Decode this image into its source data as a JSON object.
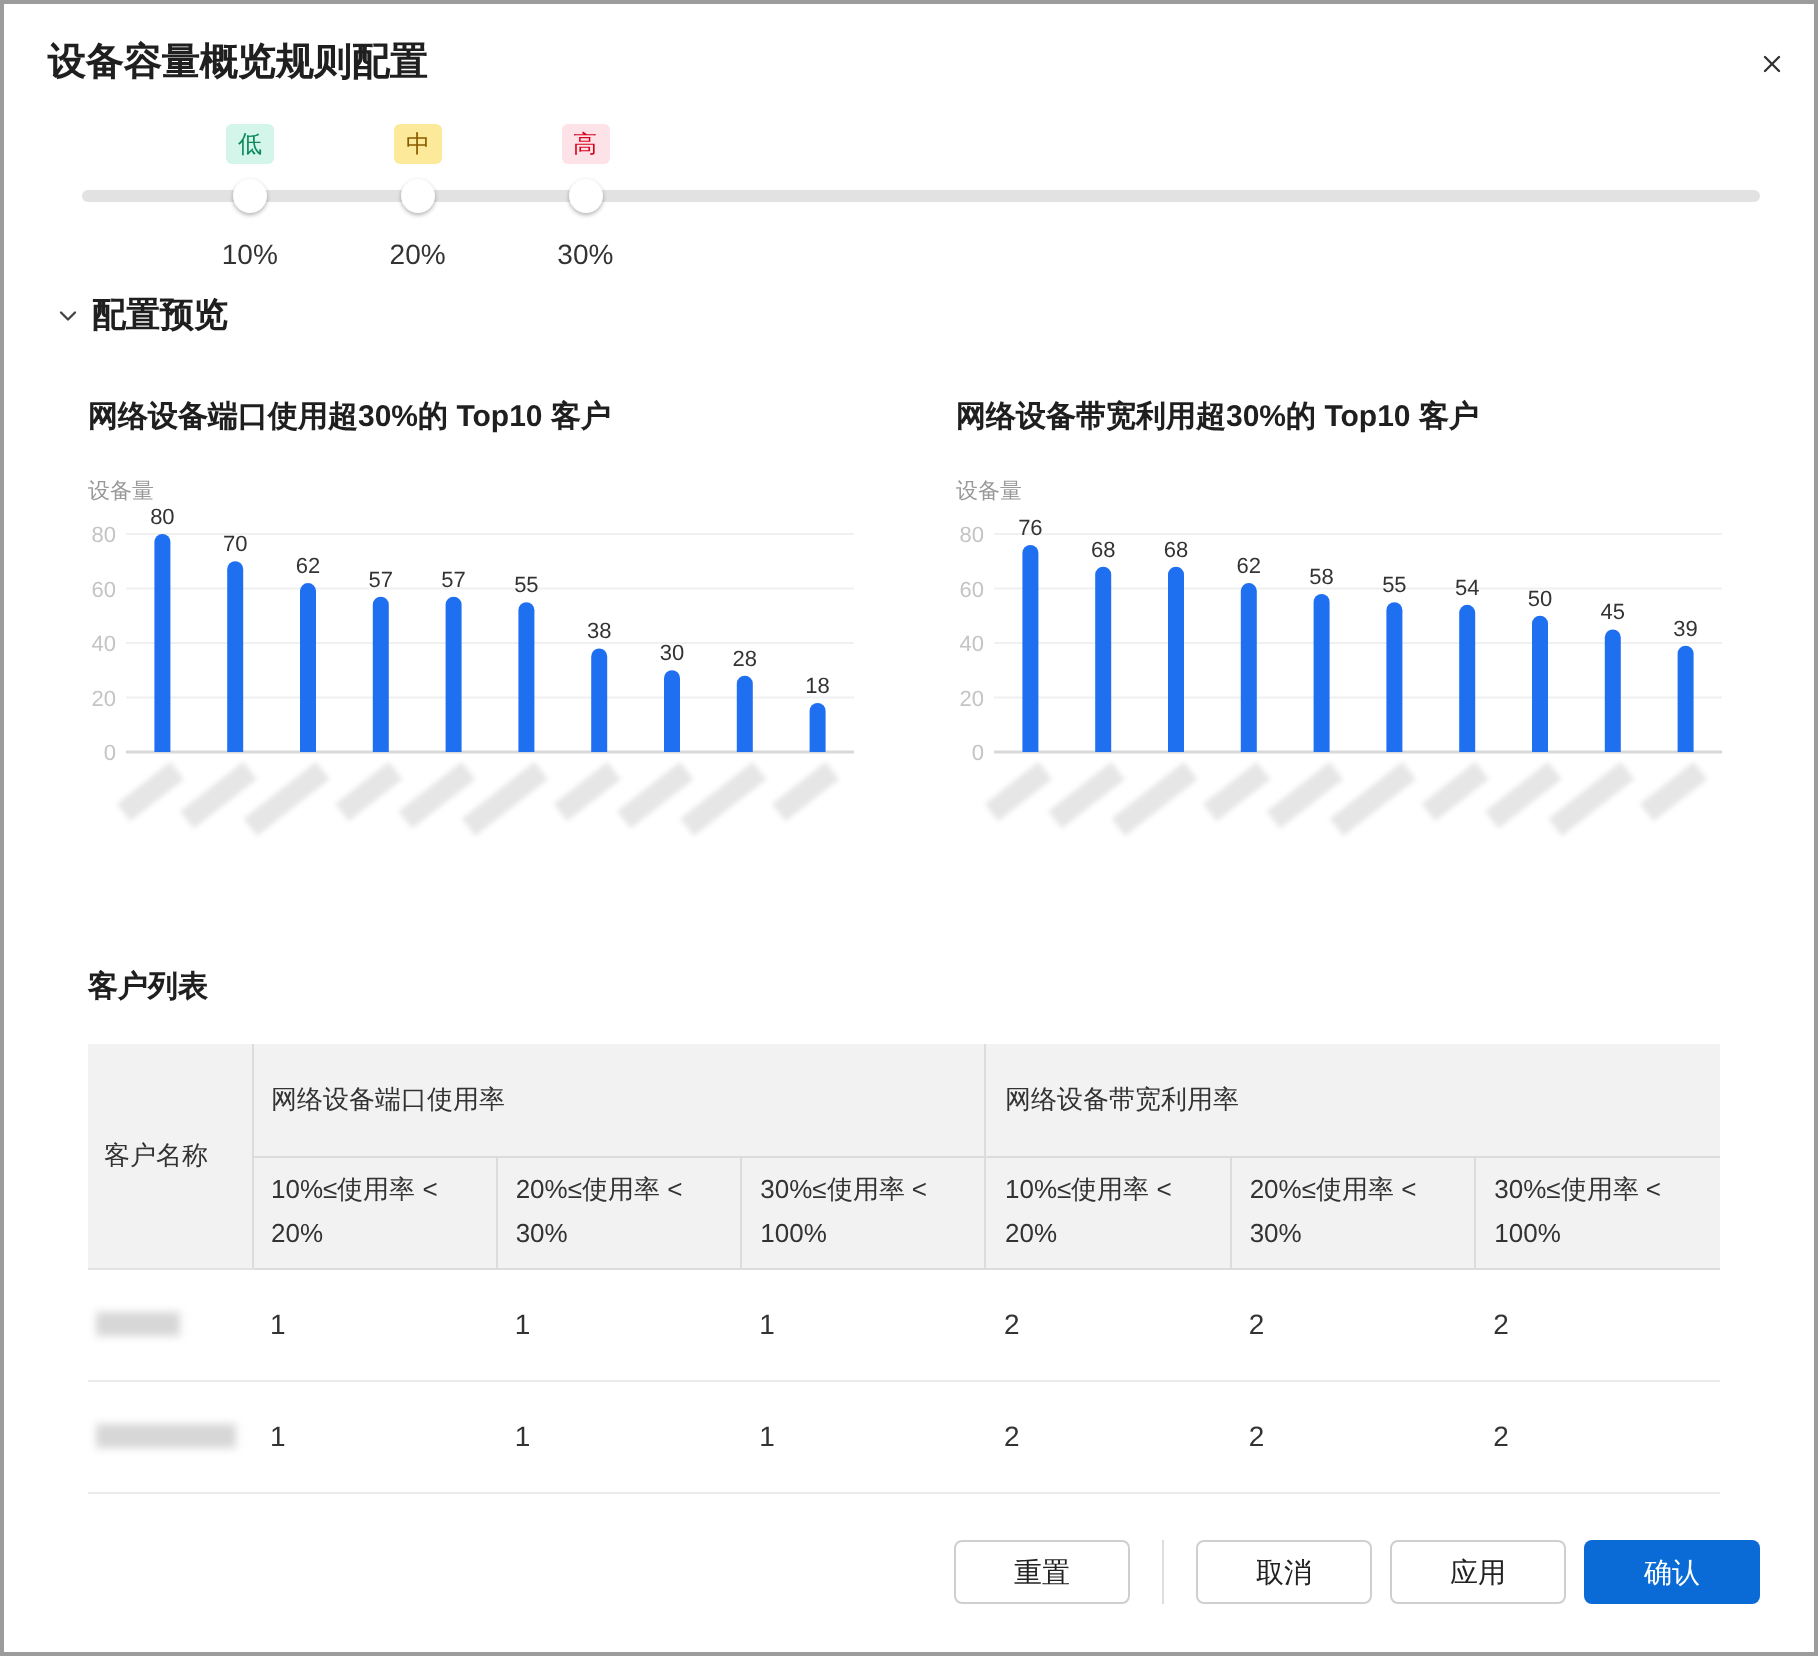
{
  "dialog": {
    "title": "设备容量概览规则配置"
  },
  "thresholds": [
    {
      "kind": "low",
      "badge": "低",
      "label": "10%",
      "level": 0.1
    },
    {
      "kind": "medium",
      "badge": "中",
      "label": "20%",
      "level": 0.2
    },
    {
      "kind": "high",
      "badge": "高",
      "label": "30%",
      "level": 0.3
    }
  ],
  "preview": {
    "title": "配置预览",
    "expanded": true,
    "charts": [
      {
        "title": "网络设备端口使用超30%的 Top10 客户",
        "chart_data": {
          "type": "bar",
          "ylabel": "设备量",
          "values": [
            80,
            70,
            62,
            57,
            57,
            55,
            38,
            30,
            28,
            18
          ],
          "ylim": [
            0,
            80
          ],
          "yticks": [
            0,
            20,
            40,
            60,
            80
          ],
          "grid": true,
          "data_labels": true
        }
      },
      {
        "title": "网络设备带宽利用超30%的 Top10 客户",
        "chart_data": {
          "type": "bar",
          "ylabel": "设备量",
          "values": [
            76,
            68,
            68,
            62,
            58,
            55,
            54,
            50,
            45,
            39
          ],
          "ylim": [
            0,
            80
          ],
          "yticks": [
            0,
            20,
            40,
            60,
            80
          ],
          "grid": true,
          "data_labels": true
        }
      }
    ]
  },
  "customer_table": {
    "title": "客户列表",
    "name_column": "客户名称",
    "groups": [
      {
        "label": "网络设备端口使用率",
        "columns": [
          "10%≤使用率 < 20%",
          "20%≤使用率 < 30%",
          "30%≤使用率 < 100%"
        ]
      },
      {
        "label": "网络设备带宽利用率",
        "columns": [
          "10%≤使用率 < 20%",
          "20%≤使用率 < 30%",
          "30%≤使用率 < 100%"
        ]
      }
    ],
    "rows": [
      {
        "values": [
          "1",
          "1",
          "1",
          "2",
          "2",
          "2"
        ]
      },
      {
        "values": [
          "1",
          "1",
          "1",
          "2",
          "2",
          "2"
        ]
      }
    ]
  },
  "buttons": [
    {
      "label": "重置",
      "kind": "reset"
    },
    {
      "label": "取消",
      "kind": "default"
    },
    {
      "label": "应用",
      "kind": "default"
    },
    {
      "label": "确认",
      "kind": "primary"
    }
  ]
}
